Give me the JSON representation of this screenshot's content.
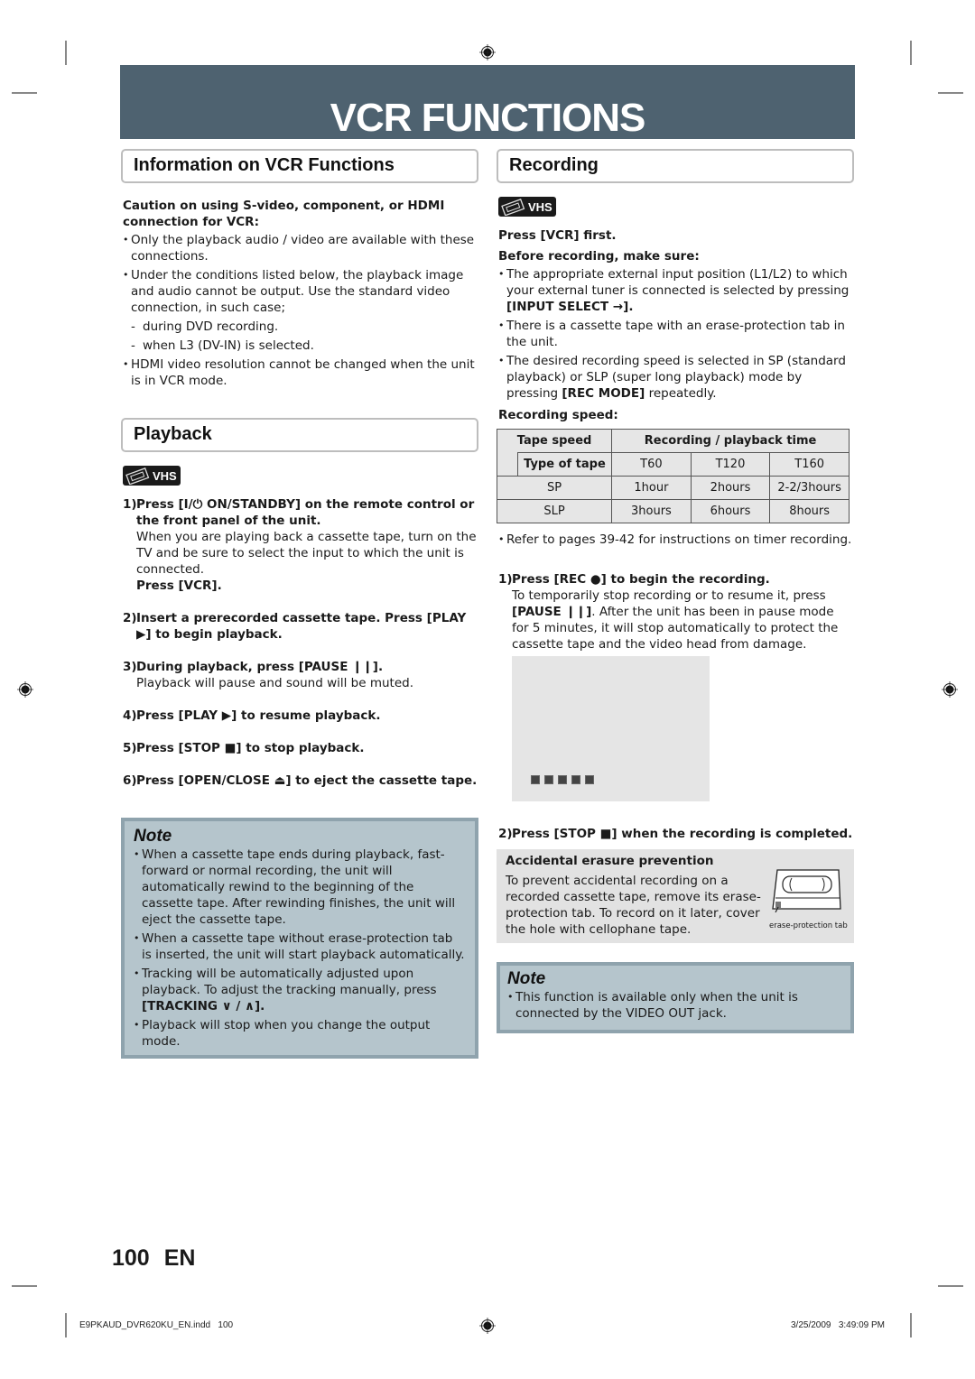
{
  "banner": {
    "title": "VCR FUNCTIONS"
  },
  "info_section": {
    "title": "Information on VCR Functions",
    "caution_heading": "Caution on using S-video, component, or HDMI connection for VCR:",
    "bullets": [
      "Only the playback audio / video are available with these connections.",
      "Under the conditions listed below, the playback image and audio cannot be output. Use the standard video connection, in such case;"
    ],
    "dashes": [
      "during DVD recording.",
      "when L3 (DV-IN) is selected."
    ],
    "last_bullet": "HDMI video resolution cannot be changed when the unit is in VCR mode."
  },
  "playback_section": {
    "title": "Playback",
    "vhs_badge": "VHS",
    "steps": [
      {
        "num": "1)",
        "text": "Press [I/⏻ ON/STANDBY] on the remote control or the front panel of the unit.",
        "detail": "When you are playing back a cassette tape, turn on the TV and be sure to select the input to which the unit is connected.",
        "extra": "Press [VCR]."
      },
      {
        "num": "2)",
        "text": "Insert a prerecorded cassette tape. Press [PLAY ▶] to begin playback."
      },
      {
        "num": "3)",
        "text": "During playback, press [PAUSE ❙❙].",
        "detail": "Playback will pause and sound will be muted."
      },
      {
        "num": "4)",
        "text": "Press [PLAY ▶] to resume playback."
      },
      {
        "num": "5)",
        "text": "Press [STOP ■] to stop playback."
      },
      {
        "num": "6)",
        "text": "Press [OPEN/CLOSE ⏏] to eject the cassette tape."
      }
    ],
    "note": {
      "title": "Note",
      "bullets": [
        "When a cassette tape ends during playback, fast-forward or normal recording, the unit will automatically rewind to the beginning of the cassette tape. After rewinding finishes, the unit will eject the cassette tape.",
        "When a cassette tape without erase-protection tab is inserted, the unit will start playback automatically.",
        "Tracking will be automatically adjusted upon playback. To adjust the tracking manually, press",
        "Playback will stop when you change the output mode."
      ],
      "tracking_label": "[TRACKING ∨ / ∧]."
    }
  },
  "recording_section": {
    "title": "Recording",
    "vhs_badge": "VHS",
    "press_first": "Press [VCR] first.",
    "before_heading": "Before recording, make sure:",
    "bullets": [
      "The appropriate external input position (L1/L2) to which your external tuner is connected is selected by pressing",
      "There is a cassette tape with an erase-protection tab in the unit.",
      "The desired recording speed is selected in SP (standard playback) or SLP (super long playback) mode by pressing"
    ],
    "input_select_label": "[INPUT SELECT →].",
    "rec_mode_label": "[REC MODE]",
    "rec_mode_suffix": " repeatedly.",
    "speed_heading": "Recording speed:",
    "table": {
      "header_tape_speed": "Tape speed",
      "header_rec_time": "Recording / playback time",
      "header_type": "Type of tape",
      "tape_types": [
        "T60",
        "T120",
        "T160"
      ],
      "rows": [
        {
          "speed": "SP",
          "values": [
            "1hour",
            "2hours",
            "2-2/3hours"
          ]
        },
        {
          "speed": "SLP",
          "values": [
            "3hours",
            "6hours",
            "8hours"
          ]
        }
      ]
    },
    "refer_text": "Refer to pages 39-42 for instructions on timer recording.",
    "step1": {
      "num": "1)",
      "text": "Press [REC ●] to begin the recording.",
      "detail_pre": "To temporarily stop recording or to resume it, press ",
      "pause_label": "[PAUSE ❙❙]",
      "detail_post": ". After the unit has been in pause mode for 5 minutes, it will stop automatically to protect the cassette tape and the video head from damage."
    },
    "step2": {
      "num": "2)",
      "text": "Press [STOP ■] when the recording is completed."
    },
    "erasure": {
      "title": "Accidental erasure prevention",
      "text": "To prevent accidental recording on a recorded cassette tape, remove its erase-protection tab. To record on it later, cover the hole with cellophane tape.",
      "tab_label": "erase-protection tab"
    },
    "note": {
      "title": "Note",
      "bullets": [
        "This function is available only when the unit is connected by the VIDEO OUT jack."
      ]
    }
  },
  "footer": {
    "page_number": "100",
    "language": "EN",
    "file_info": "E9PKAUD_DVR620KU_EN.indd   100",
    "timestamp": "3/25/2009   3:49:09 PM"
  }
}
